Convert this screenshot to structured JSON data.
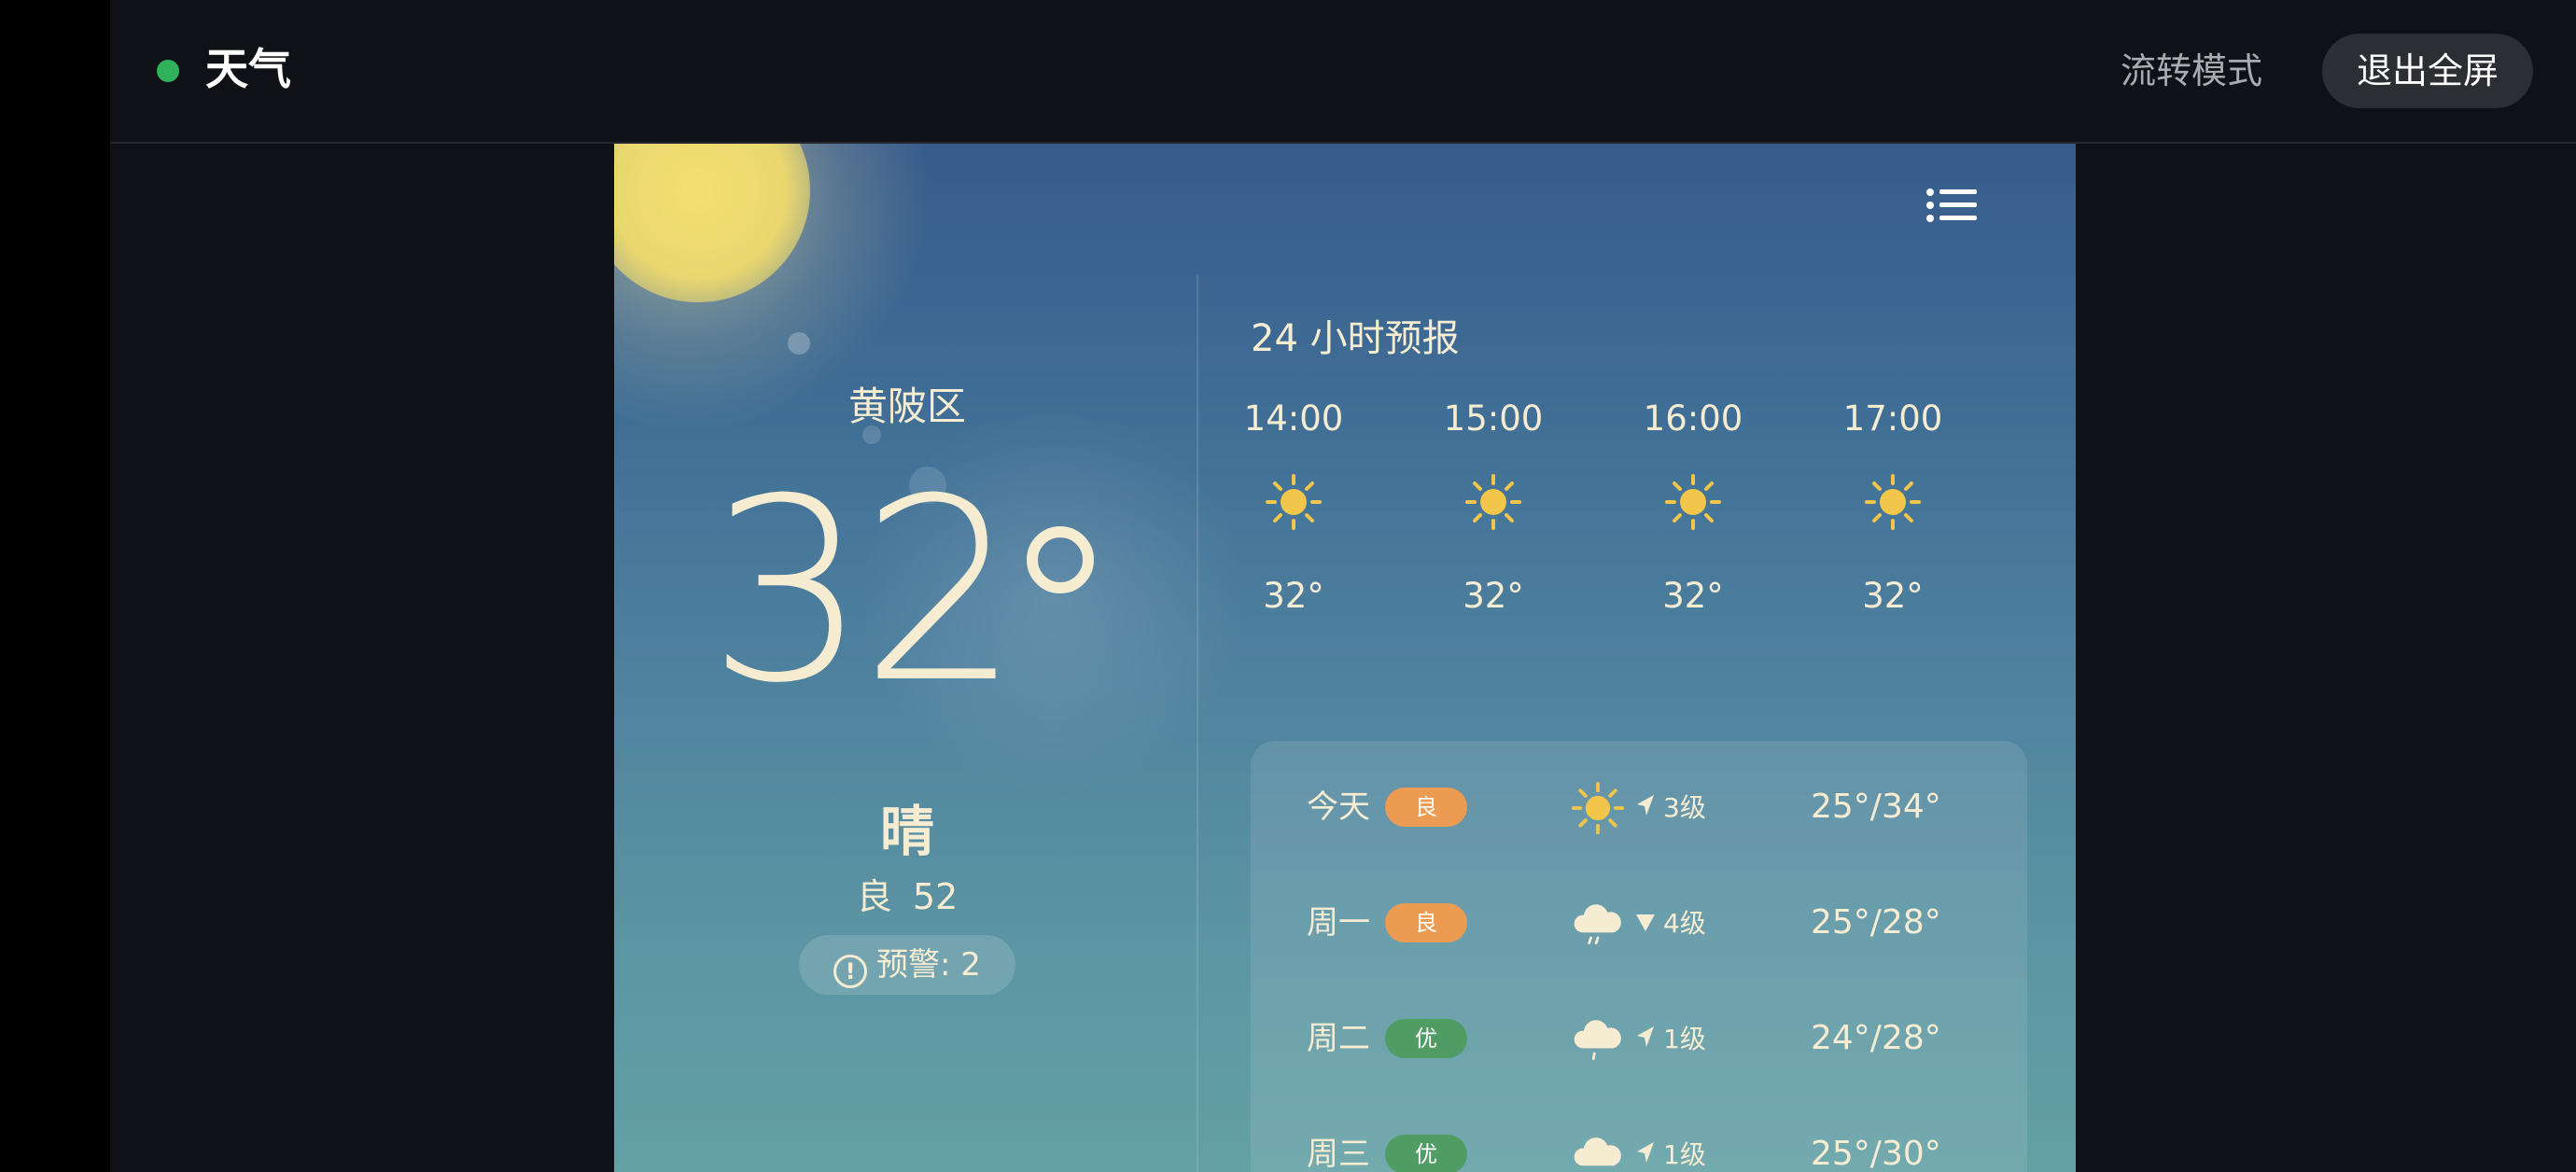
{
  "window": {
    "app_title": "天气",
    "flow_mode_label": "流转模式",
    "exit_fullscreen_label": "退出全屏"
  },
  "colors": {
    "status_dot": "#2fb35a",
    "aqi_good": "#eb9b52",
    "aqi_excellent": "#4f9d64",
    "sun": "#f2c54b"
  },
  "current": {
    "location": "黄陂区",
    "temperature": "32",
    "condition": "晴",
    "aqi_label": "良",
    "aqi_value": "52",
    "warning_text": "预警: 2"
  },
  "hourly": {
    "title": "24 小时预报",
    "items": [
      {
        "time": "14:00",
        "icon": "sun-icon",
        "temp": "32°"
      },
      {
        "time": "15:00",
        "icon": "sun-icon",
        "temp": "32°"
      },
      {
        "time": "16:00",
        "icon": "sun-icon",
        "temp": "32°"
      },
      {
        "time": "17:00",
        "icon": "sun-icon",
        "temp": "32°"
      }
    ]
  },
  "daily": [
    {
      "day": "今天",
      "aqi": "良",
      "icon": "sun-icon",
      "wind": "3级",
      "range": "25°/34°"
    },
    {
      "day": "周一",
      "aqi": "良",
      "icon": "rain-cloud-icon",
      "wind": "4级",
      "range": "25°/28°"
    },
    {
      "day": "周二",
      "aqi": "优",
      "icon": "cloud-drizzle-icon",
      "wind": "1级",
      "range": "24°/28°"
    },
    {
      "day": "周三",
      "aqi": "优",
      "icon": "cloud-icon",
      "wind": "1级",
      "range": "25°/30°"
    }
  ]
}
